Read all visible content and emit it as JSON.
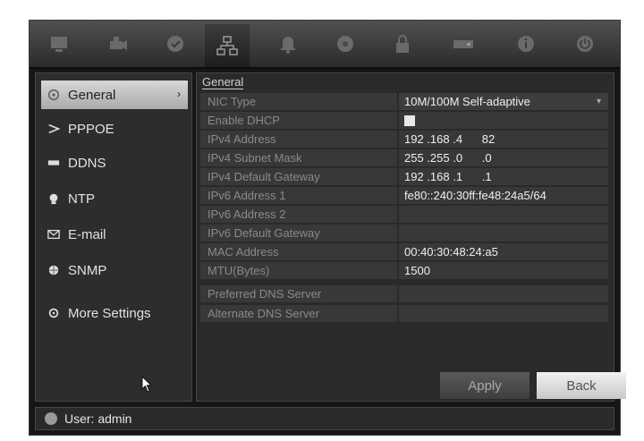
{
  "topbar": {
    "tabs": [
      {
        "icon": "monitor-icon"
      },
      {
        "icon": "camera-icon"
      },
      {
        "icon": "record-icon"
      },
      {
        "icon": "network-icon",
        "active": true
      },
      {
        "icon": "alarm-bell-icon"
      },
      {
        "icon": "hdd-icon"
      },
      {
        "icon": "user-lock-icon"
      },
      {
        "icon": "storage-icon"
      },
      {
        "icon": "info-icon"
      },
      {
        "icon": "power-icon"
      }
    ]
  },
  "sidebar": {
    "items": [
      {
        "label": "General",
        "icon": "gear-icon"
      },
      {
        "label": "PPPOE",
        "icon": "pppoe-icon"
      },
      {
        "label": "DDNS",
        "icon": "ddns-icon"
      },
      {
        "label": "NTP",
        "icon": "ntp-icon"
      },
      {
        "label": "E-mail",
        "icon": "email-icon"
      },
      {
        "label": "SNMP",
        "icon": "snmp-icon"
      },
      {
        "label": "More Settings",
        "icon": "more-settings-icon"
      }
    ],
    "active_arrow": "›"
  },
  "main": {
    "breadcrumb": "General",
    "rows": [
      {
        "label": "NIC Type",
        "value": "10M/100M Self-adaptive"
      },
      {
        "label": "Enable DHCP",
        "value": ""
      },
      {
        "label": "IPv4 Address",
        "value": "192 .168 .4      82"
      },
      {
        "label": "IPv4 Subnet Mask",
        "value": "255 .255 .0      .0"
      },
      {
        "label": "IPv4 Default Gateway",
        "value": "192 .168 .1      .1"
      },
      {
        "label": "IPv6 Address 1",
        "value": "fe80::240:30ff:fe48:24a5/64"
      },
      {
        "label": "IPv6 Address 2",
        "value": ""
      },
      {
        "label": "IPv6 Default Gateway",
        "value": ""
      },
      {
        "label": "MAC Address",
        "value": "00:40:30:48:24:a5"
      },
      {
        "label": "MTU(Bytes)",
        "value": "1500"
      },
      {
        "label": "Preferred DNS Server",
        "value": ""
      },
      {
        "label": "Alternate DNS Server",
        "value": ""
      }
    ],
    "dropdown_arrow": "▾",
    "apply_label": "Apply",
    "back_label": "Back"
  },
  "status": {
    "user_text": "User: admin"
  }
}
